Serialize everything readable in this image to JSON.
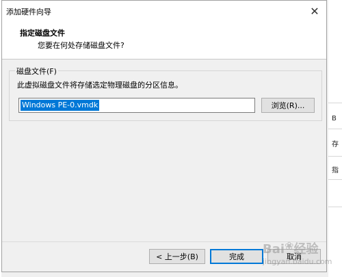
{
  "background": {
    "right_edge_chars": [
      "B",
      "存",
      "指"
    ]
  },
  "dialog": {
    "title": "添加硬件向导",
    "close_glyph": "✕",
    "header": {
      "title": "指定磁盘文件",
      "subtitle": "您要在何处存储磁盘文件?"
    },
    "group": {
      "legend": "磁盘文件(F)",
      "description": "此虚拟磁盘文件将存储选定物理磁盘的分区信息。",
      "file_value": "Windows PE-0.vmdk",
      "browse_label": "浏览(R)..."
    },
    "footer": {
      "back_label": "< 上一步(B)",
      "finish_label": "完成",
      "cancel_label": "取消"
    }
  },
  "watermark": {
    "text": "Bai",
    "text2": "经验",
    "sub": "jingyan.baidu.com"
  },
  "colors": {
    "accent": "#0078d7",
    "dialog_bg": "#f0f0f0",
    "header_bg": "#ffffff"
  }
}
